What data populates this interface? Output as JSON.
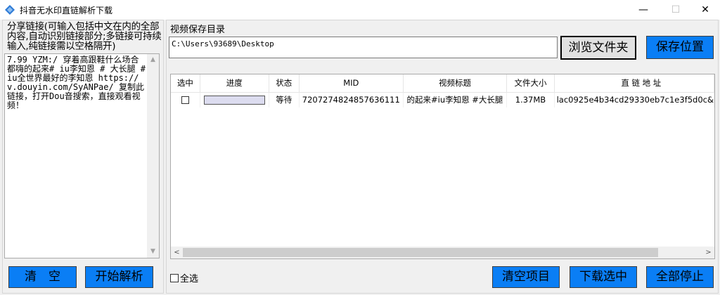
{
  "window": {
    "title": "抖音无水印直链解析下载",
    "minimize": "—",
    "maximize": "☐",
    "close": "✕"
  },
  "left": {
    "share_label": "分享链接(可输入包括中文在内的全部内容,自动识别链接部分;多链接可持续输入,纯链接需以空格隔开)",
    "share_text": "7.99 YZM:/ 穿着高跟鞋什么场合都嗨的起来# iu李知恩 # 大长腿 # iu全世界最好的李知恩 https://v.douyin.com/SyANPae/ 复制此链接，打开Dou音搜索，直接观看视频！",
    "clear_button": "清　空",
    "parse_button": "开始解析"
  },
  "save": {
    "label": "视频保存目录",
    "path": "C:\\Users\\93689\\Desktop",
    "browse_button": "浏览文件夹",
    "save_button": "保存位置"
  },
  "table": {
    "headers": [
      "选中",
      "进度",
      "状态",
      "MID",
      "视频标题",
      "文件大小",
      "直 链 地 址"
    ],
    "rows": [
      {
        "checked": false,
        "progress": 0,
        "status": "等待",
        "mid": "7207274824857636111",
        "title": "的起来#iu李知恩 #大长腿",
        "size": "1.37MB",
        "url": "lac0925e4b34cd29330eb7c1e3f5d0c&"
      }
    ]
  },
  "footer": {
    "select_all": "全选",
    "clear_items_button": "清空项目",
    "download_button": "下载选中",
    "stop_button": "全部停止"
  },
  "colors": {
    "button_blue": "#0a7ef5",
    "progress_track": "#dcdcef"
  },
  "icons": {
    "app": "douyin-diamond-icon",
    "scroll_up": "chevron-up-icon",
    "scroll_down": "chevron-down-icon",
    "scroll_left": "chevron-left-icon",
    "scroll_right": "chevron-right-icon"
  }
}
